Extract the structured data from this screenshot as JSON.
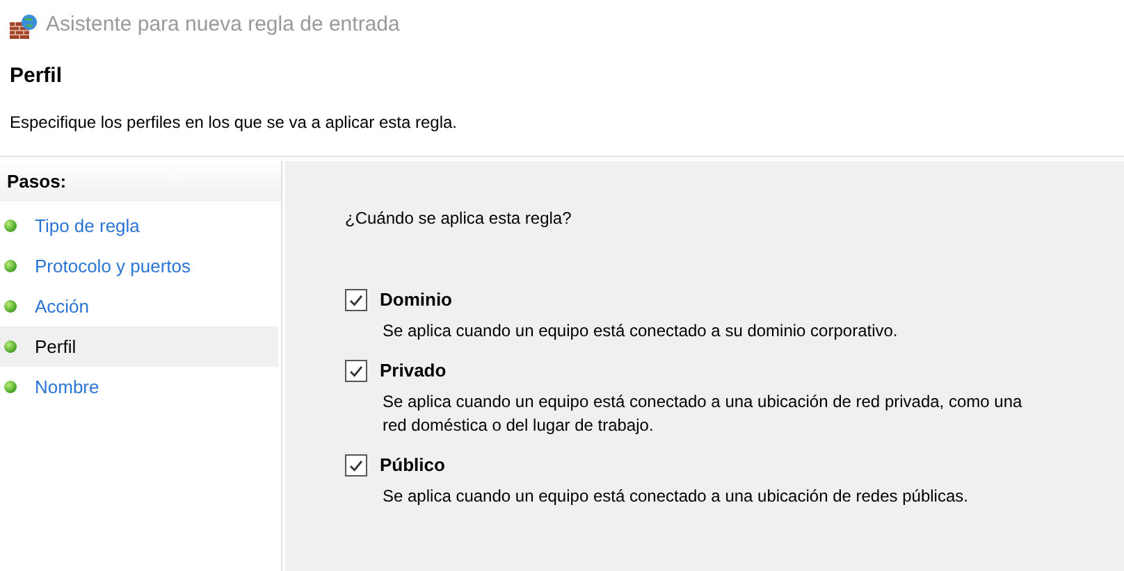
{
  "window": {
    "title": "Asistente para nueva regla de entrada"
  },
  "header": {
    "title": "Perfil",
    "subtitle": "Especifique los perfiles en los que se va a aplicar esta regla."
  },
  "steps": {
    "title": "Pasos:",
    "items": [
      {
        "label": "Tipo de regla",
        "selected": false
      },
      {
        "label": "Protocolo y puertos",
        "selected": false
      },
      {
        "label": "Acción",
        "selected": false
      },
      {
        "label": "Perfil",
        "selected": true
      },
      {
        "label": "Nombre",
        "selected": false
      }
    ]
  },
  "question": "¿Cuándo se aplica esta regla?",
  "profiles": [
    {
      "label": "Dominio",
      "checked": true,
      "description": "Se aplica cuando un equipo está conectado a su dominio corporativo."
    },
    {
      "label": "Privado",
      "checked": true,
      "description": "Se aplica cuando un equipo está conectado a una ubicación de red privada, como una red doméstica o del lugar de trabajo."
    },
    {
      "label": "Público",
      "checked": true,
      "description": "Se aplica cuando un equipo está conectado a una ubicación de redes públicas."
    }
  ]
}
